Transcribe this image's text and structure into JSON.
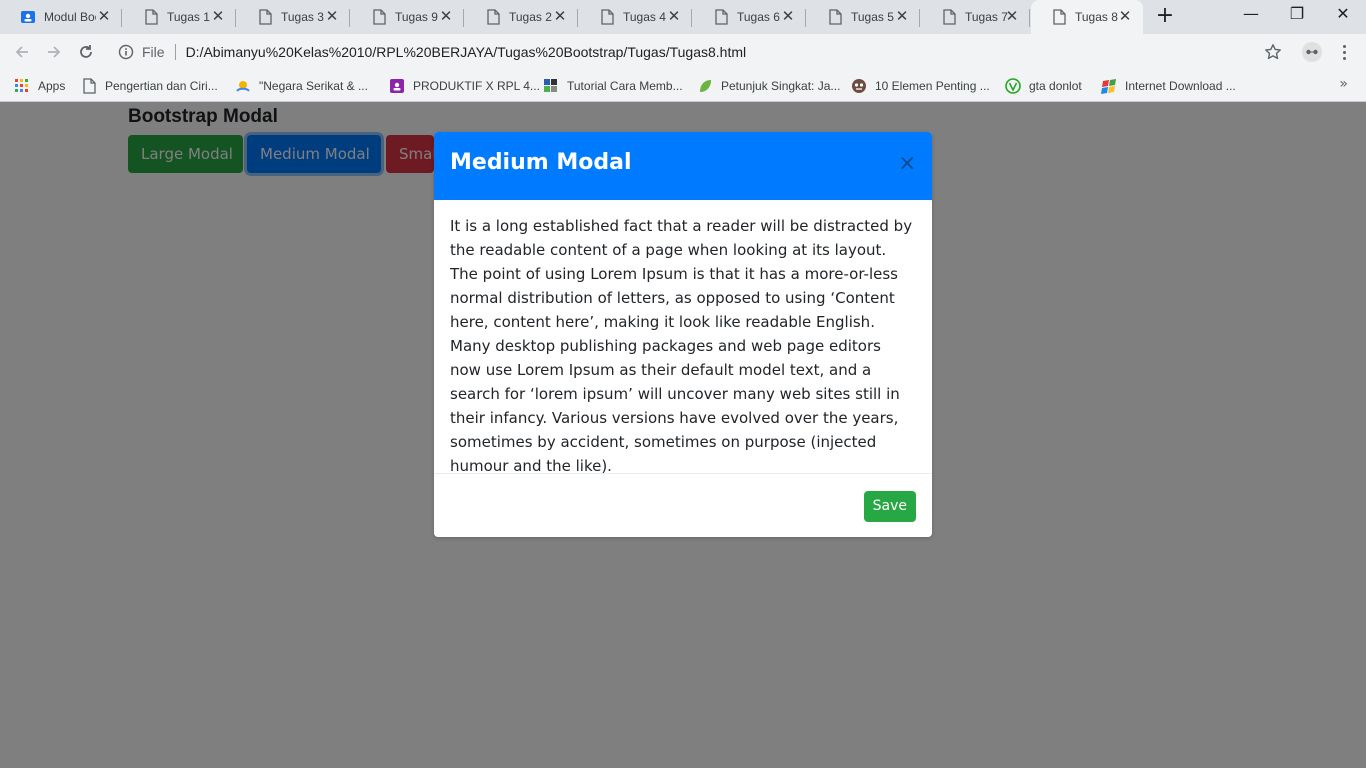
{
  "browser": {
    "tabs": [
      {
        "title": "Modul Bootstrap",
        "icon": "classroom-icon"
      },
      {
        "title": "Tugas 1",
        "icon": "file-icon"
      },
      {
        "title": "Tugas 3",
        "icon": "file-icon"
      },
      {
        "title": "Tugas 9",
        "icon": "file-icon"
      },
      {
        "title": "Tugas 2",
        "icon": "file-icon"
      },
      {
        "title": "Tugas 4",
        "icon": "file-icon"
      },
      {
        "title": "Tugas 6",
        "icon": "file-icon"
      },
      {
        "title": "Tugas 5",
        "icon": "file-icon"
      },
      {
        "title": "Tugas 7",
        "icon": "file-icon"
      },
      {
        "title": "Tugas 8",
        "icon": "file-icon",
        "active": true
      }
    ],
    "close_glyph": "✕",
    "new_tab_glyph": "+",
    "window": {
      "minimize": "—",
      "restore": "❐",
      "close": "✕"
    },
    "address": {
      "scheme_label": "File",
      "url": "D:/Abimanyu%20Kelas%2010/RPL%20BERJAYA/Tugas%20Bootstrap/Tugas/Tugas8.html"
    },
    "bookmarks": [
      {
        "label": "Apps",
        "icon": "apps-grid-icon"
      },
      {
        "label": "Pengertian dan Ciri...",
        "icon": "file-icon"
      },
      {
        "label": "\"Negara Serikat & ...",
        "icon": "globe-icon"
      },
      {
        "label": "PRODUKTIF X RPL 4...",
        "icon": "classroom-icon"
      },
      {
        "label": "Tutorial Cara Memb...",
        "icon": "tutorial-icon"
      },
      {
        "label": "Petunjuk Singkat: Ja...",
        "icon": "leaf-icon"
      },
      {
        "label": "10 Elemen Penting ...",
        "icon": "face-icon"
      },
      {
        "label": "gta donlot",
        "icon": "shield-icon"
      },
      {
        "label": "Internet Download ...",
        "icon": "idm-icon"
      }
    ],
    "bookmarks_more": "»"
  },
  "page": {
    "title": "Bootstrap Modal",
    "buttons": {
      "large": "Large Modal",
      "medium": "Medium Modal",
      "small": "Small Modal"
    }
  },
  "modal": {
    "title": "Medium Modal",
    "close_glyph": "×",
    "body": "It is a long established fact that a reader will be distracted by the readable content of a page when looking at its layout. The point of using Lorem Ipsum is that it has a more-or-less normal distribution of letters, as opposed to using ‘Content here, content here’, making it look like readable English. Many desktop publishing packages and web page editors now use Lorem Ipsum as their default model text, and a search for ‘lorem ipsum’ will uncover many web sites still in their infancy. Various versions have evolved over the years, sometimes by accident, sometimes on purpose (injected humour and the like).",
    "save_label": "Save"
  },
  "colors": {
    "primary": "#007bff",
    "success": "#28a745",
    "danger": "#dc3545",
    "backdrop": "rgba(0,0,0,0.5)"
  }
}
